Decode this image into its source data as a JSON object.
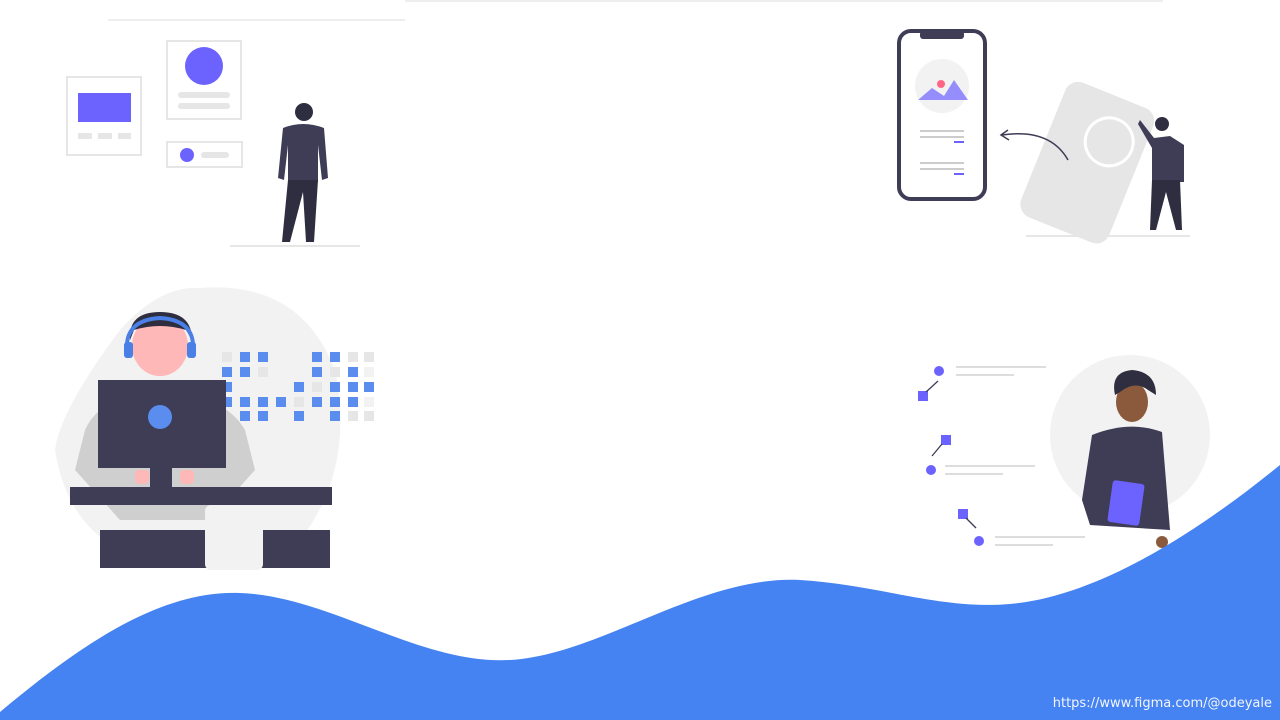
{
  "footer": {
    "credit_link": "https://www.figma.com/@odeyale"
  },
  "colors": {
    "wave": "#4582f2",
    "accent_purple": "#6c63ff",
    "dark_figure": "#3f3d56",
    "light_gray": "#f0f0f0"
  }
}
